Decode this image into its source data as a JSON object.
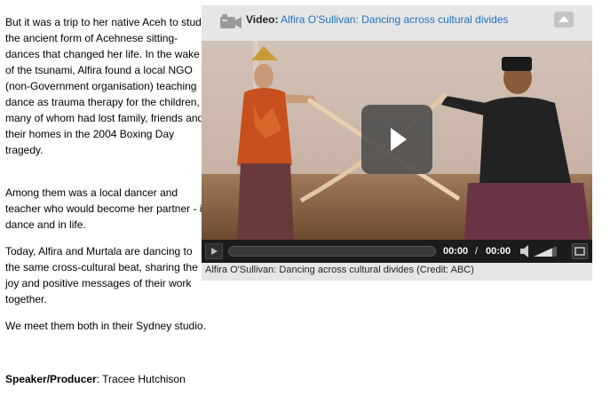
{
  "article": {
    "paragraph1": "But it was a trip to her native Aceh to study the ancient form of Acehnese sitting-dances that changed her life. In the wake of the tsunami, Alfira found a local NGO (non-Government organisation) teaching dance as trauma therapy for the children, many of whom had lost family, friends and their homes in the 2004 Boxing Day tragedy.",
    "paragraph2": "Among them was a local dancer and teacher who would become her partner - in dance and in life.",
    "paragraph3": "Today, Alfira and Murtala are dancing to the same cross-cultural beat, sharing the joy and positive messages of their work together.",
    "paragraph4": "We meet them both in their Sydney studio.",
    "credit_label": "Speaker/Producer",
    "credit_value": ": Tracee Hutchison"
  },
  "video": {
    "label": "Video:",
    "title": "Alfira O'Sullivan: Dancing across cultural divides",
    "current_time": "00:00",
    "separator": "/",
    "duration": "00:00",
    "caption": "Alfira O'Sullivan: Dancing across cultural divides (Credit: ABC)",
    "progress": 0,
    "volume_level": 0.8,
    "icons": {
      "header": "video-camera-icon",
      "collapse": "chevron-up-icon",
      "play": "play-icon",
      "volume": "speaker-icon",
      "fullscreen": "fullscreen-icon"
    }
  },
  "colors": {
    "link": "#1e6fc0",
    "panel": "#e6e6e6",
    "controls": "#1b1b1b"
  }
}
